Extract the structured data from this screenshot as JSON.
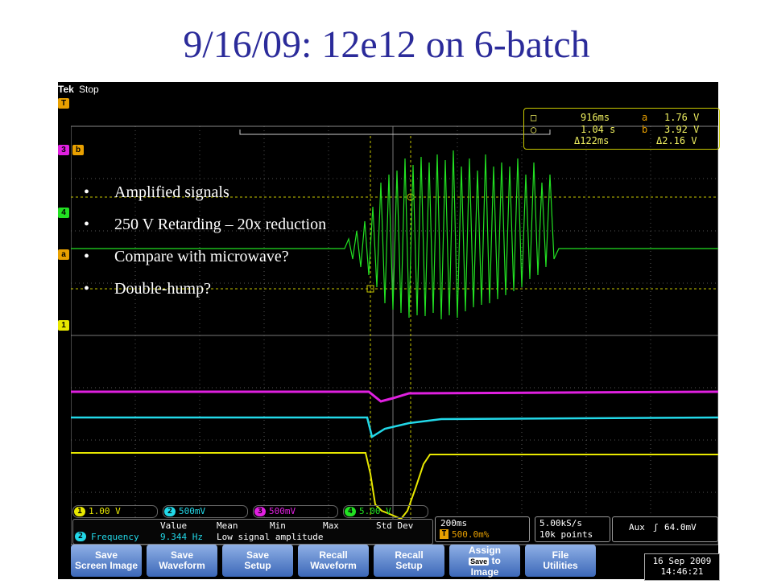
{
  "slide": {
    "title": "9/16/09: 12e12 on 6-batch"
  },
  "bullets": [
    "Amplified signals",
    "250 V Retarding – 20x reduction",
    "Compare with microwave?",
    "Double-hump?"
  ],
  "scope": {
    "brand": "Tek",
    "state": "Stop",
    "trigger_marker": "T",
    "markers": {
      "ref3": "3",
      "b": "b",
      "ch4": "4",
      "a": "a",
      "ch1": "1"
    },
    "cursors": {
      "time1": "916ms",
      "time2": "1.04 s",
      "delta_time": "Δ122ms",
      "a_label": "a",
      "a_value": "1.76 V",
      "b_label": "b",
      "b_value": "3.92 V",
      "delta_v": "Δ2.16 V"
    },
    "channels": [
      {
        "num": "1",
        "scale": "1.00 V",
        "color": "#e8e800"
      },
      {
        "num": "2",
        "scale": "500mV",
        "color": "#22d8e8"
      },
      {
        "num": "3",
        "scale": "500mV",
        "color": "#e020e0"
      },
      {
        "num": "4",
        "scale": "5.00 V",
        "color": "#22e022"
      }
    ],
    "measurement": {
      "headers": [
        "Value",
        "Mean",
        "Min",
        "Max",
        "Std Dev"
      ],
      "channel": "2",
      "name": "Frequency",
      "value": "9.344 Hz",
      "note": "Low signal amplitude"
    },
    "timebase": {
      "scale": "200ms",
      "trigger_pos": "500.0m%",
      "trigger_marker": "T"
    },
    "acquisition": {
      "rate": "5.00kS/s",
      "points": "10k points"
    },
    "trigger": {
      "source": "Aux",
      "slope": "ʃ",
      "level": "64.0mV"
    },
    "softkeys": [
      {
        "l1": "Save",
        "l2": "Screen Image"
      },
      {
        "l1": "Save",
        "l2": "Waveform"
      },
      {
        "l1": "Save",
        "l2": "Setup"
      },
      {
        "l1": "Recall",
        "l2": "Waveform"
      },
      {
        "l1": "Recall",
        "l2": "Setup"
      },
      {
        "l1": "Assign",
        "l2": "to",
        "l3": "Image",
        "badge": "Save"
      },
      {
        "l1": "File",
        "l2": "Utilities"
      }
    ],
    "date": "16 Sep  2009",
    "time": "14:46:21"
  }
}
